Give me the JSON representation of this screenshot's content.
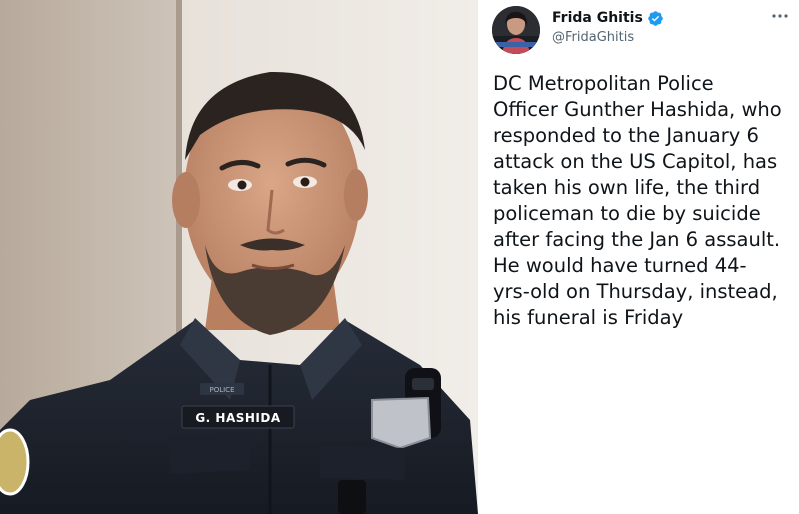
{
  "photo": {
    "name_tag": "G. HASHIDA",
    "badge_tag": "POLICE"
  },
  "tweet": {
    "author_name": "Frida Ghitis",
    "author_handle": "@FridaGhitis",
    "verified": true,
    "avatar_icon": "avatar-photo-icon",
    "more_icon": "more-options-icon",
    "text_lines": [
      "DC Metropolitan Police",
      "Officer Gunther Hashida, who",
      "responded to the January 6",
      "attack on the US Capitol, has",
      "taken his own life, the third",
      "policeman to die by suicide",
      "after facing the Jan 6 assault.",
      "He would have turned 44-",
      "yrs-old on Thursday, instead,",
      "his funeral is Friday"
    ]
  },
  "colors": {
    "verified": "#1d9bf0",
    "text": "#0f1419",
    "secondary": "#536471",
    "uniform": "#1f2530"
  }
}
